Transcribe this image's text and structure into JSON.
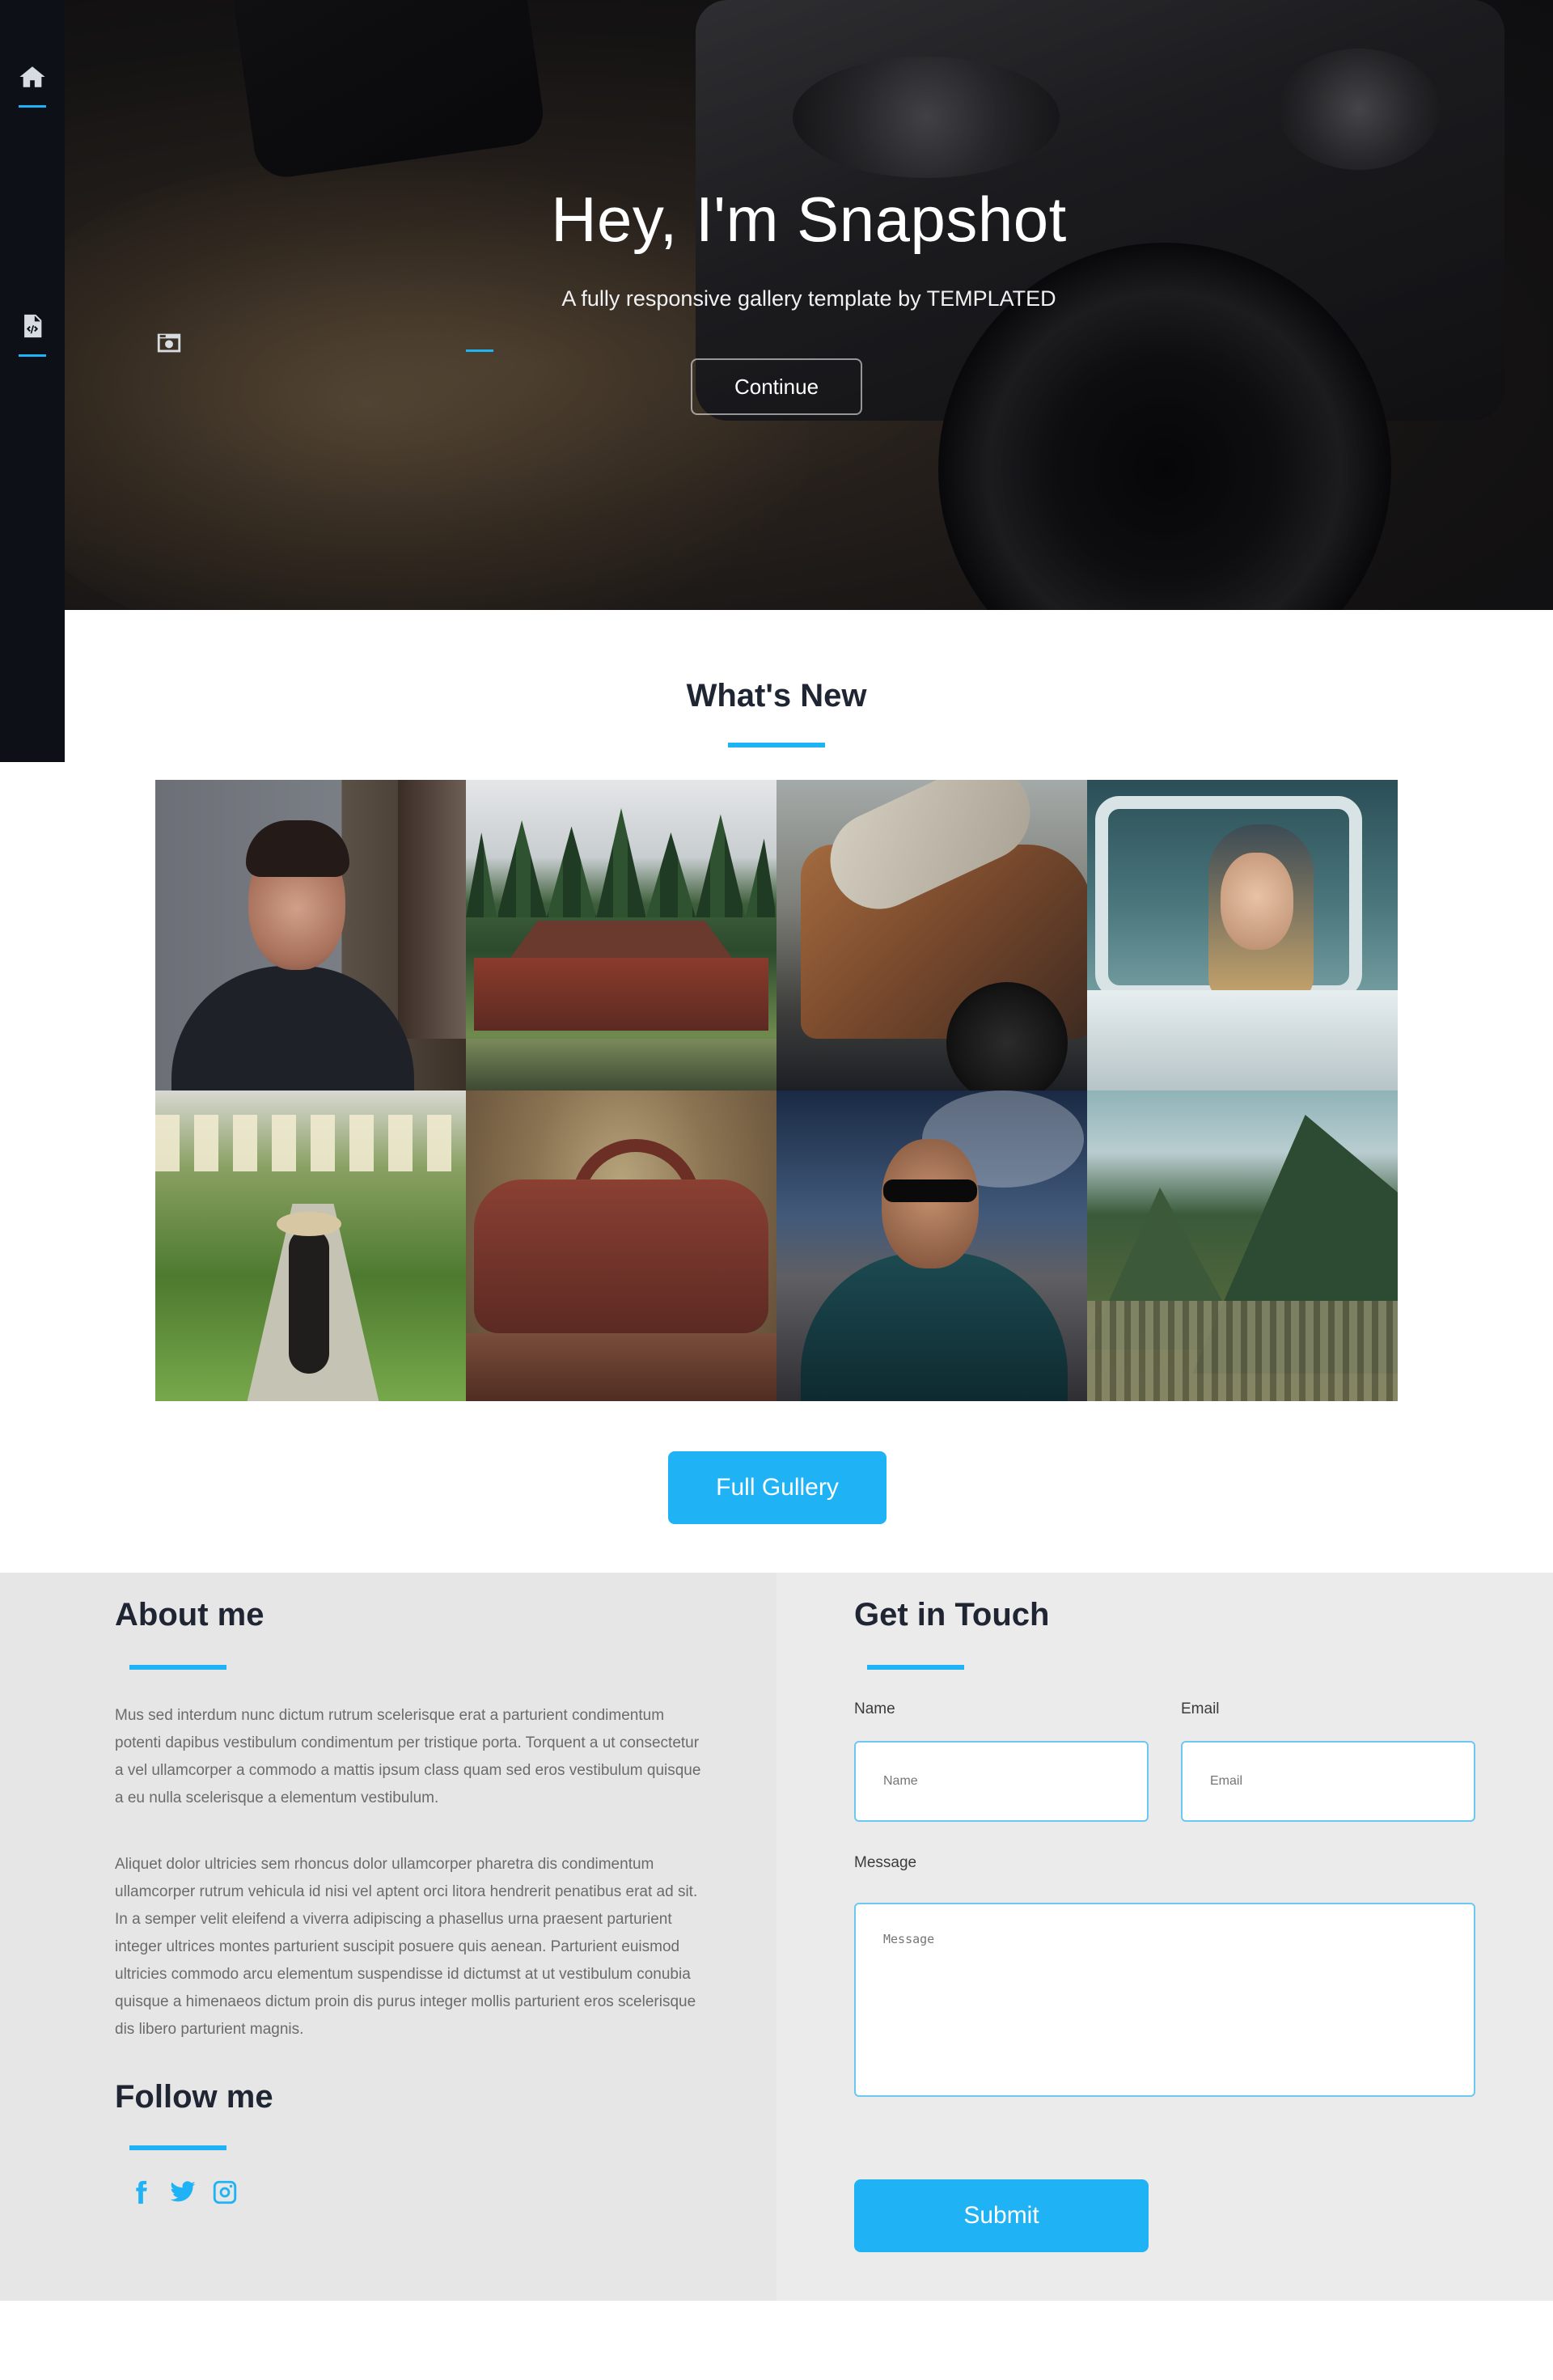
{
  "sidebar": {
    "items": [
      {
        "name": "home",
        "icon": "home-icon"
      },
      {
        "name": "gallery",
        "icon": "camera-icon"
      },
      {
        "name": "source",
        "icon": "code-file-icon"
      }
    ],
    "accent": "#1fb2f5",
    "background": "#0d1117"
  },
  "hero": {
    "title": "Hey, I'm Snapshot",
    "subtitle": "A fully responsive gallery template by TEMPLATED",
    "button_label": "Continue"
  },
  "whats_new": {
    "title": "What's New",
    "images": [
      {
        "label": "portrait-man"
      },
      {
        "label": "japanese-temple"
      },
      {
        "label": "rusty-truck"
      },
      {
        "label": "woman-in-car"
      },
      {
        "label": "lantern-path"
      },
      {
        "label": "leather-bag"
      },
      {
        "label": "man-smoking"
      },
      {
        "label": "mountain-ruins"
      }
    ],
    "button_label": "Full Gullery"
  },
  "about": {
    "title": "About me",
    "paragraph1": "Mus sed interdum nunc dictum rutrum scelerisque erat a parturient condimentum potenti dapibus vestibulum condimentum per tristique porta. Torquent a ut consectetur a vel ullamcorper a commodo a mattis ipsum class quam sed eros vestibulum quisque a eu nulla scelerisque a elementum vestibulum.",
    "paragraph2": "Aliquet dolor ultricies sem rhoncus dolor ullamcorper pharetra dis condimentum ullamcorper rutrum vehicula id nisi vel aptent orci litora hendrerit penatibus erat ad sit. In a semper velit eleifend a viverra adipiscing a phasellus urna praesent parturient integer ultrices montes parturient suscipit posuere quis aenean. Parturient euismod ultricies commodo arcu elementum suspendisse id dictumst at ut vestibulum conubia quisque a himenaeos dictum proin dis purus integer mollis parturient eros scelerisque dis libero parturient magnis.",
    "follow_title": "Follow me",
    "social": [
      "facebook-icon",
      "twitter-icon",
      "instagram-icon"
    ]
  },
  "contact": {
    "title": "Get in Touch",
    "name_label": "Name",
    "name_placeholder": "Name",
    "email_label": "Email",
    "email_placeholder": "Email",
    "message_label": "Message",
    "message_placeholder": "Message",
    "submit_label": "Submit"
  }
}
